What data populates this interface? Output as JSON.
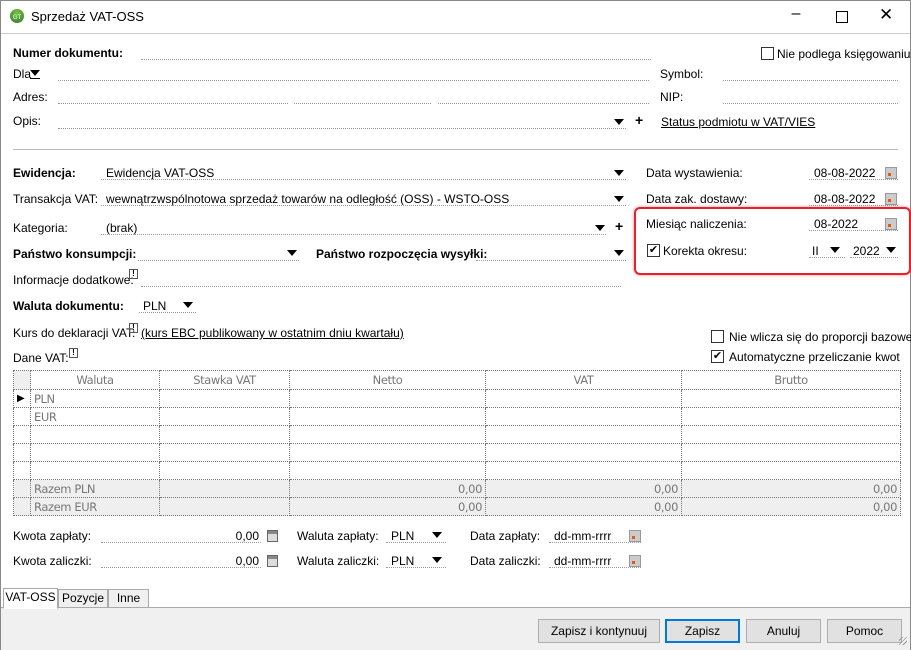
{
  "window": {
    "title": "Sprzedaż VAT-OSS",
    "logo": "GT"
  },
  "header": {
    "numer_label": "Numer dokumentu:",
    "nie_podlega": "Nie podlega księgowaniu",
    "dla_label": "Dla",
    "symbol_label": "Symbol:",
    "adres_label": "Adres:",
    "nip_label": "NIP:",
    "opis_label": "Opis:",
    "vies_link": "Status podmiotu w VAT/VIES"
  },
  "form": {
    "ewidencja_label": "Ewidencja:",
    "ewidencja_value": "Ewidencja VAT-OSS",
    "transakcja_label": "Transakcja VAT:",
    "transakcja_value": "wewnątrzwspólnotowa sprzedaż towarów na odległość (OSS) - WSTO-OSS",
    "kategoria_label": "Kategoria:",
    "kategoria_value": "(brak)",
    "panstwo_konsumpcji": "Państwo konsumpcji:",
    "panstwo_wysylki": "Państwo rozpoczęcia wysyłki:",
    "info_dodatkowe": "Informacje dodatkowe:",
    "waluta_label": "Waluta dokumentu:",
    "waluta_value": "PLN",
    "kurs_label": "Kurs do deklaracji VAT:",
    "kurs_link": "(kurs EBC publikowany w ostatnim dniu kwartału)",
    "dane_vat": "Dane VAT:",
    "plus": "+"
  },
  "dates": {
    "wystawienia_label": "Data wystawienia:",
    "wystawienia_value": "08-08-2022",
    "dostawy_label": "Data zak. dostawy:",
    "dostawy_value": "08-08-2022",
    "miesiac_label": "Miesiąc naliczenia:",
    "miesiac_value": "08-2022",
    "korekta_label": "Korekta okresu:",
    "korekta_checked": true,
    "korekta_okres": "II",
    "korekta_rok": "2022",
    "highlight_color": "#e8202a"
  },
  "options": {
    "nie_wlicza": "Nie wlicza się do proporcji bazowej",
    "nie_wlicza_checked": false,
    "auto_przeliczanie": "Automatyczne przeliczanie kwot",
    "auto_checked": true
  },
  "table": {
    "columns": [
      "Waluta",
      "Stawka VAT",
      "Netto",
      "VAT",
      "Brutto"
    ],
    "rows": [
      "PLN",
      "EUR",
      "",
      "",
      ""
    ],
    "totals": [
      {
        "label": "Razem PLN",
        "netto": "0,00",
        "vat": "0,00",
        "brutto": "0,00"
      },
      {
        "label": "Razem EUR",
        "netto": "0,00",
        "vat": "0,00",
        "brutto": "0,00"
      }
    ]
  },
  "payment": {
    "kwota_zaplaty_label": "Kwota zapłaty:",
    "kwota_zaplaty": "0,00",
    "waluta_zaplaty_label": "Waluta zapłaty:",
    "waluta_zaplaty": "PLN",
    "data_zaplaty_label": "Data zapłaty:",
    "data_zaplaty": "dd-mm-rrrr",
    "kwota_zaliczki_label": "Kwota zaliczki:",
    "kwota_zaliczki": "0,00",
    "waluta_zaliczki_label": "Waluta zaliczki:",
    "waluta_zaliczki": "PLN",
    "data_zaliczki_label": "Data zaliczki:",
    "data_zaliczki": "dd-mm-rrrr"
  },
  "tabs": [
    "VAT-OSS",
    "Pozycje",
    "Inne"
  ],
  "buttons": {
    "zapisz_kontynuuj": "Zapisz i kontynuuj",
    "zapisz": "Zapisz",
    "anuluj": "Anuluj",
    "pomoc": "Pomoc"
  }
}
